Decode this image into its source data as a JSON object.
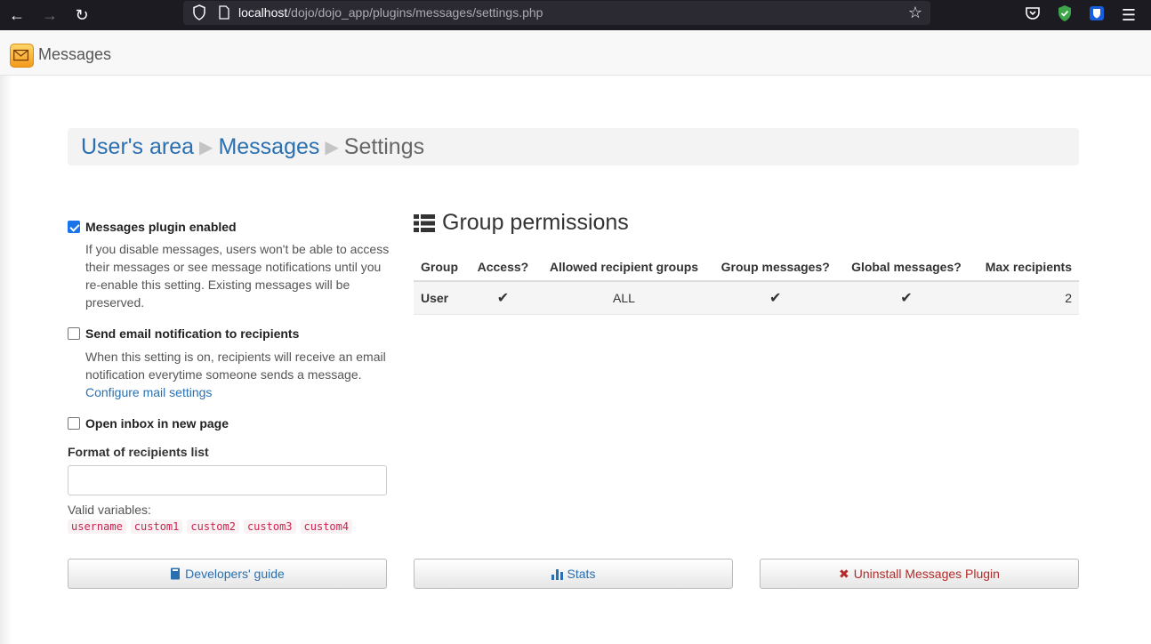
{
  "browser": {
    "url_host": "localhost",
    "url_path": "/dojo/dojo_app/plugins/messages/settings.php"
  },
  "app": {
    "title": "Messages"
  },
  "breadcrumb": {
    "items": [
      "User's area",
      "Messages"
    ],
    "current": "Settings"
  },
  "settings": {
    "enabled": {
      "label": "Messages plugin enabled",
      "checked": true,
      "description": "If you disable messages, users won't be able to access their messages or see message notifications until you re-enable this setting. Existing messages will be preserved."
    },
    "email": {
      "label": "Send email notification to recipients",
      "checked": false,
      "description": "When this setting is on, recipients will receive an email notification everytime someone sends a message.",
      "link": "Configure mail settings"
    },
    "inbox": {
      "label": "Open inbox in new page",
      "checked": false
    },
    "format": {
      "label": "Format of recipients list",
      "value": "",
      "vars_label": "Valid variables:",
      "vars": [
        "username",
        "custom1",
        "custom2",
        "custom3",
        "custom4"
      ]
    }
  },
  "permissions": {
    "title": "Group permissions",
    "headers": [
      "Group",
      "Access?",
      "Allowed recipient groups",
      "Group messages?",
      "Global messages?",
      "Max recipients"
    ],
    "rows": [
      {
        "group": "User",
        "access": "✔",
        "allowed": "ALL",
        "group_messages": "✔",
        "global_messages": "✔",
        "max": "2"
      }
    ]
  },
  "buttons": {
    "dev_guide": "Developers' guide",
    "stats": "Stats",
    "uninstall": "Uninstall Messages Plugin"
  },
  "colors": {
    "link": "#2a6fb0",
    "danger": "#b42a2a",
    "check": "#3a8a3a"
  }
}
